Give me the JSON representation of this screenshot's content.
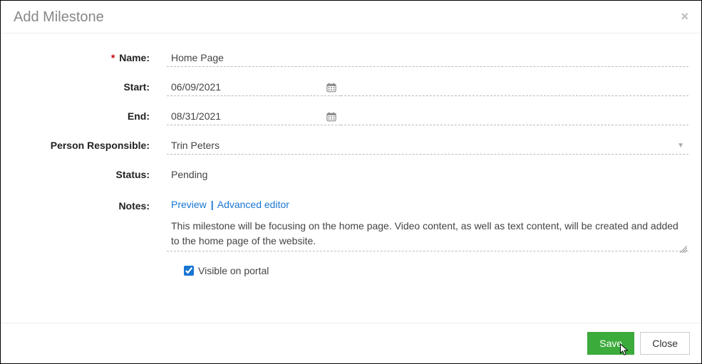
{
  "modal": {
    "title": "Add Milestone"
  },
  "fields": {
    "name_label": "Name:",
    "name_value": "Home Page",
    "start_label": "Start:",
    "start_value": "06/09/2021",
    "end_label": "End:",
    "end_value": "08/31/2021",
    "person_label": "Person Responsible:",
    "person_value": "Trin Peters",
    "status_label": "Status:",
    "status_value": "Pending",
    "notes_label": "Notes:",
    "preview_link": "Preview",
    "link_separator": "|",
    "advanced_link": "Advanced editor",
    "notes_value": "This milestone will be focusing on the home page. Video content, as well as text content, will be created and added to the home page of the website.",
    "visible_label": "Visible on portal",
    "visible_checked": true
  },
  "footer": {
    "save_label": "Save",
    "close_label": "Close"
  }
}
